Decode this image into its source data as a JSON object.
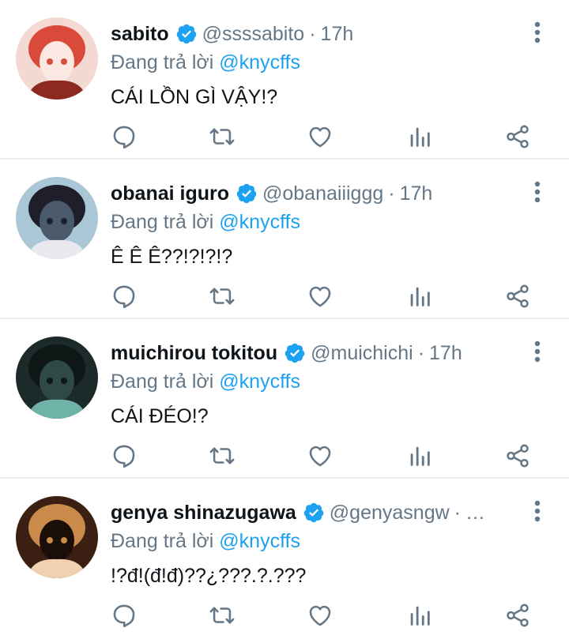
{
  "colors": {
    "accent": "#1da1f2",
    "muted": "#657786",
    "text": "#0f1419",
    "divider": "#e6ecf0"
  },
  "tweets": [
    {
      "name": "sabito",
      "handle": "@ssssabito",
      "dot": "·",
      "time": "17h",
      "reply_prefix": "Đang trả lời ",
      "reply_to": "@knycffs",
      "text": "CÁI LỒN GÌ VẬY!?",
      "avatar_colors": [
        "#f4d9d2",
        "#d94a3a",
        "#8c2a22",
        "#fbe8e2"
      ]
    },
    {
      "name": "obanai iguro",
      "handle": "@obanaiiiggg",
      "dot": "·",
      "time": "17h",
      "reply_prefix": "Đang trả lời ",
      "reply_to": "@knycffs",
      "text": "Ê Ê Ê??!?!?!?",
      "avatar_colors": [
        "#a9c7d6",
        "#1e1f2a",
        "#e9e9ee",
        "#4a5a6a"
      ]
    },
    {
      "name": "muichirou tokitou",
      "handle": "@muichichi",
      "dot": "·",
      "time": "17h",
      "reply_prefix": "Đang trả lời ",
      "reply_to": "@knycffs",
      "text": "CÁI ĐÉO!?",
      "avatar_colors": [
        "#1c2a2a",
        "#0e1616",
        "#6fb3a8",
        "#2f4a46"
      ]
    },
    {
      "name": "genya shinazugawa",
      "handle": "@genyasngw",
      "dot": "·",
      "time": "…",
      "reply_prefix": "Đang trả lời ",
      "reply_to": "@knycffs",
      "text": "!?đ!(đ!đ)??¿???.?.???",
      "avatar_colors": [
        "#3a1f12",
        "#c98a4a",
        "#f0d2b0",
        "#1a0e08"
      ]
    }
  ]
}
